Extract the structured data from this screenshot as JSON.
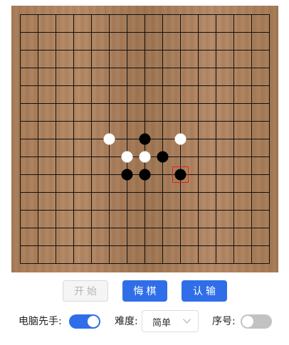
{
  "board": {
    "size": 15,
    "stones": [
      {
        "row": 7,
        "col": 5,
        "color": "white"
      },
      {
        "row": 7,
        "col": 7,
        "color": "black"
      },
      {
        "row": 7,
        "col": 9,
        "color": "white"
      },
      {
        "row": 8,
        "col": 6,
        "color": "white"
      },
      {
        "row": 8,
        "col": 7,
        "color": "white"
      },
      {
        "row": 8,
        "col": 8,
        "color": "black"
      },
      {
        "row": 9,
        "col": 6,
        "color": "black"
      },
      {
        "row": 9,
        "col": 7,
        "color": "black"
      },
      {
        "row": 9,
        "col": 9,
        "color": "black",
        "last_move": true
      }
    ],
    "colors": {
      "line": "#111111",
      "black": "#000000",
      "white": "#ffffff",
      "marker": "#e02020"
    }
  },
  "buttons": {
    "start": "开始",
    "undo": "悔棋",
    "resign": "认输"
  },
  "settings": {
    "computer_first_label": "电脑先手:",
    "computer_first_on": true,
    "difficulty_label": "难度:",
    "difficulty_value": "简单",
    "sequence_label": "序号:",
    "sequence_on": false
  },
  "accent_color": "#2f6ee8"
}
